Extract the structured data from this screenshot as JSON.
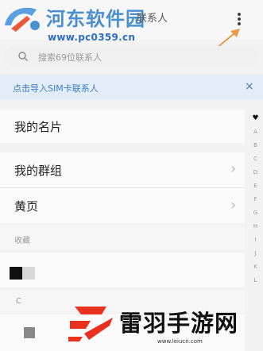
{
  "header": {
    "watermark_title": "河东软件园",
    "tab_label": "联系人",
    "watermark_url": "www.pc0359.cn"
  },
  "search": {
    "placeholder": "搜索69位联系人"
  },
  "sim_banner": {
    "text": "点击导入SIM卡联系人",
    "close_glyph": "×"
  },
  "list": {
    "my_card": "我的名片",
    "my_groups": "我的群组",
    "yellow_pages": "黄页",
    "favorites_header": "收藏",
    "section_c": "C",
    "chevron": "›"
  },
  "index": {
    "letters": [
      "♥",
      "A",
      "B",
      "C",
      "D",
      "E",
      "F",
      "G",
      "H",
      "I",
      "J",
      "K",
      "L"
    ]
  },
  "bottom_watermark": {
    "title": "雷羽手游网",
    "url": "www.leiucn.com"
  },
  "colors": {
    "accent": "#3d7bc4",
    "banner_bg": "#e3edf8",
    "arrow": "#e89a4a"
  }
}
